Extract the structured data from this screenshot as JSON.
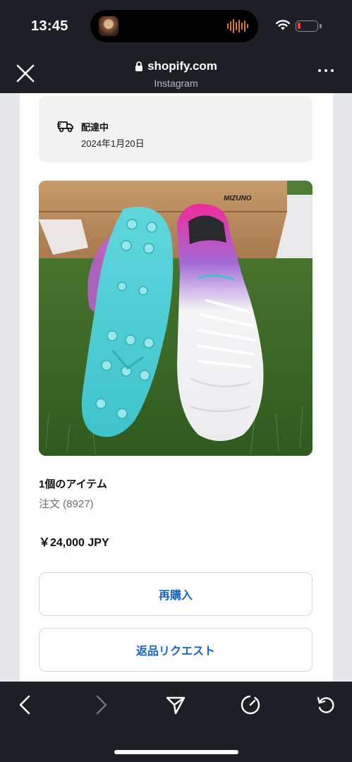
{
  "status_bar": {
    "time": "13:45",
    "icons": [
      "dynamic-island-avatar",
      "audio-waveform-icon",
      "wifi-icon",
      "battery-icon"
    ],
    "battery_level": 0.15,
    "battery_color": "#ff3b30"
  },
  "browser": {
    "url": "shopify.com",
    "source": "Instagram",
    "icons": [
      "close-icon",
      "lock-icon",
      "more-icon"
    ]
  },
  "order": {
    "delivery_status": "配達中",
    "delivery_date": "2024年1月20日",
    "items_count": "1個のアイテム",
    "order_number": "注文 (8927)",
    "total_price": "￥24,000 JPY",
    "product_image": "Mizuno soccer cleats (white/purple/pink, turquoise sole) on grass with Mizuno box"
  },
  "actions": {
    "rebuy_label": "再購入",
    "return_label": "返品リクエスト"
  },
  "toolbar": {
    "icons": [
      "back-icon",
      "forward-icon",
      "share-icon",
      "timer-icon",
      "reload-icon"
    ]
  },
  "colors": {
    "chrome_background": "#1c1f24",
    "link_blue": "#1666c5",
    "page_background": "#e6e7ea"
  }
}
